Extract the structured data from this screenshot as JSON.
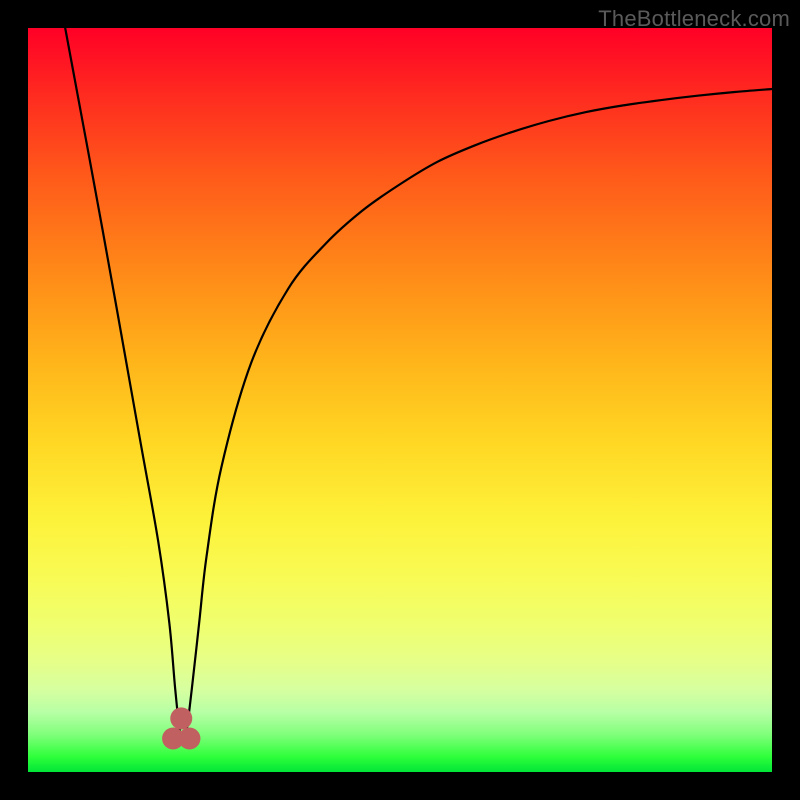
{
  "watermark": "TheBottleneck.com",
  "chart_data": {
    "type": "line",
    "title": "",
    "xlabel": "",
    "ylabel": "",
    "xlim": [
      0,
      100
    ],
    "ylim": [
      0,
      100
    ],
    "series": [
      {
        "name": "bottleneck-curve",
        "x": [
          5,
          10,
          15,
          17.5,
          19,
          19.8,
          20.5,
          21.2,
          22,
          23,
          24,
          26,
          30,
          35,
          40,
          45,
          50,
          55,
          60,
          65,
          70,
          75,
          80,
          85,
          90,
          95,
          100
        ],
        "y": [
          100,
          73,
          45,
          31,
          20,
          11,
          5,
          5,
          11,
          20,
          29,
          41,
          55,
          65,
          71,
          75.5,
          79,
          82,
          84.2,
          86,
          87.5,
          88.7,
          89.6,
          90.3,
          90.9,
          91.4,
          91.8
        ]
      }
    ],
    "markers": [
      {
        "name": "nub-left",
        "x": 19.5,
        "y": 4.5
      },
      {
        "name": "nub-mid",
        "x": 20.6,
        "y": 7.2
      },
      {
        "name": "nub-right",
        "x": 21.7,
        "y": 4.5
      }
    ],
    "marker_color": "#c16060",
    "curve_color": "#000000"
  }
}
